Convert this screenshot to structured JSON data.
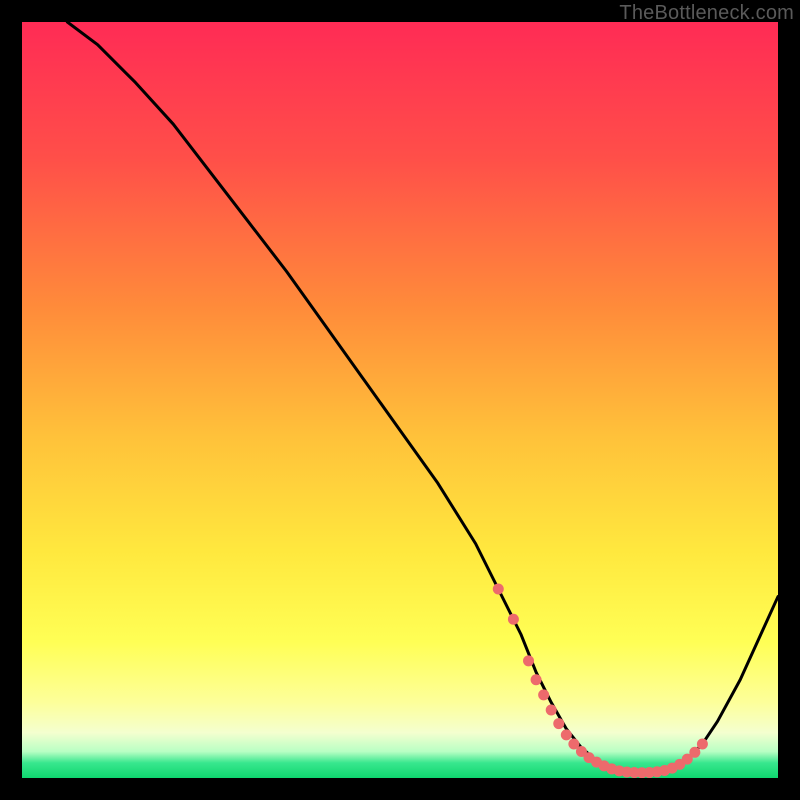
{
  "attribution": "TheBottleneck.com",
  "colors": {
    "gradient_top": "#ff2b55",
    "gradient_mid1": "#ff7a3c",
    "gradient_mid2": "#ffd23a",
    "gradient_mid3": "#ffff4a",
    "gradient_mid4": "#f6ff9e",
    "gradient_bottom_yellow": "#ffffd0",
    "gradient_green": "#12e07a",
    "curve": "#000000",
    "marker": "#ed6a6c"
  },
  "chart_data": {
    "type": "line",
    "title": "",
    "xlabel": "",
    "ylabel": "",
    "xlim": [
      0,
      100
    ],
    "ylim": [
      0,
      100
    ],
    "series": [
      {
        "name": "bottleneck-curve",
        "x": [
          6,
          10,
          15,
          20,
          25,
          30,
          35,
          40,
          45,
          50,
          55,
          60,
          63,
          66,
          68,
          70,
          72,
          74,
          76,
          78,
          80,
          82,
          84,
          86,
          88,
          90,
          92,
          95,
          100
        ],
        "y": [
          100,
          97,
          92,
          86.5,
          80,
          73.5,
          67,
          60,
          53,
          46,
          39,
          31,
          25,
          19,
          14,
          10,
          6.5,
          4,
          2.3,
          1.3,
          0.8,
          0.7,
          0.8,
          1.3,
          2.5,
          4.5,
          7.5,
          13,
          24
        ]
      }
    ],
    "markers": {
      "name": "flat-region-markers",
      "x": [
        63,
        65,
        67,
        68,
        69,
        70,
        71,
        72,
        73,
        74,
        75,
        76,
        77,
        78,
        79,
        80,
        81,
        82,
        83,
        84,
        85,
        86,
        87,
        88,
        89,
        90
      ],
      "y": [
        25,
        21,
        15.5,
        13,
        11,
        9,
        7.2,
        5.7,
        4.5,
        3.5,
        2.7,
        2.1,
        1.6,
        1.2,
        0.95,
        0.8,
        0.72,
        0.7,
        0.73,
        0.82,
        1.0,
        1.3,
        1.8,
        2.5,
        3.4,
        4.5
      ]
    }
  }
}
